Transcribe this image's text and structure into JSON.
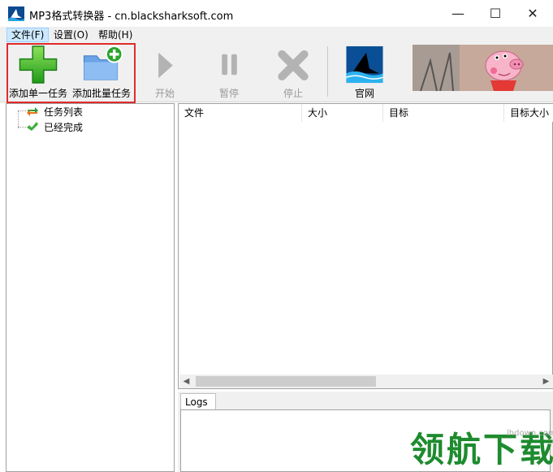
{
  "window": {
    "title": "MP3格式转换器 - cn.blacksharksoft.com",
    "minimize": "—",
    "maximize": "☐",
    "close": "✕"
  },
  "menu": [
    {
      "label": "文件(F)"
    },
    {
      "label": "设置(O)"
    },
    {
      "label": "帮助(H)"
    }
  ],
  "toolbar": {
    "add_single": "添加单一任务",
    "add_batch": "添加批量任务",
    "start": "开始",
    "pause": "暂停",
    "stop": "停止",
    "website": "官网"
  },
  "tree": {
    "items": [
      {
        "label": "任务列表",
        "icon": "refresh-arrows-icon"
      },
      {
        "label": "已经完成",
        "icon": "checkmark-icon"
      }
    ]
  },
  "table": {
    "columns": [
      "文件",
      "大小",
      "目标",
      "目标大小"
    ]
  },
  "logs": {
    "tab_label": "Logs"
  },
  "watermark": {
    "text": "领航下载",
    "url": "lhdown.com"
  },
  "colors": {
    "highlight": "#e02b2b",
    "toolbar_bg": "#f0f0f0",
    "watermark": "#1e8b2e"
  }
}
